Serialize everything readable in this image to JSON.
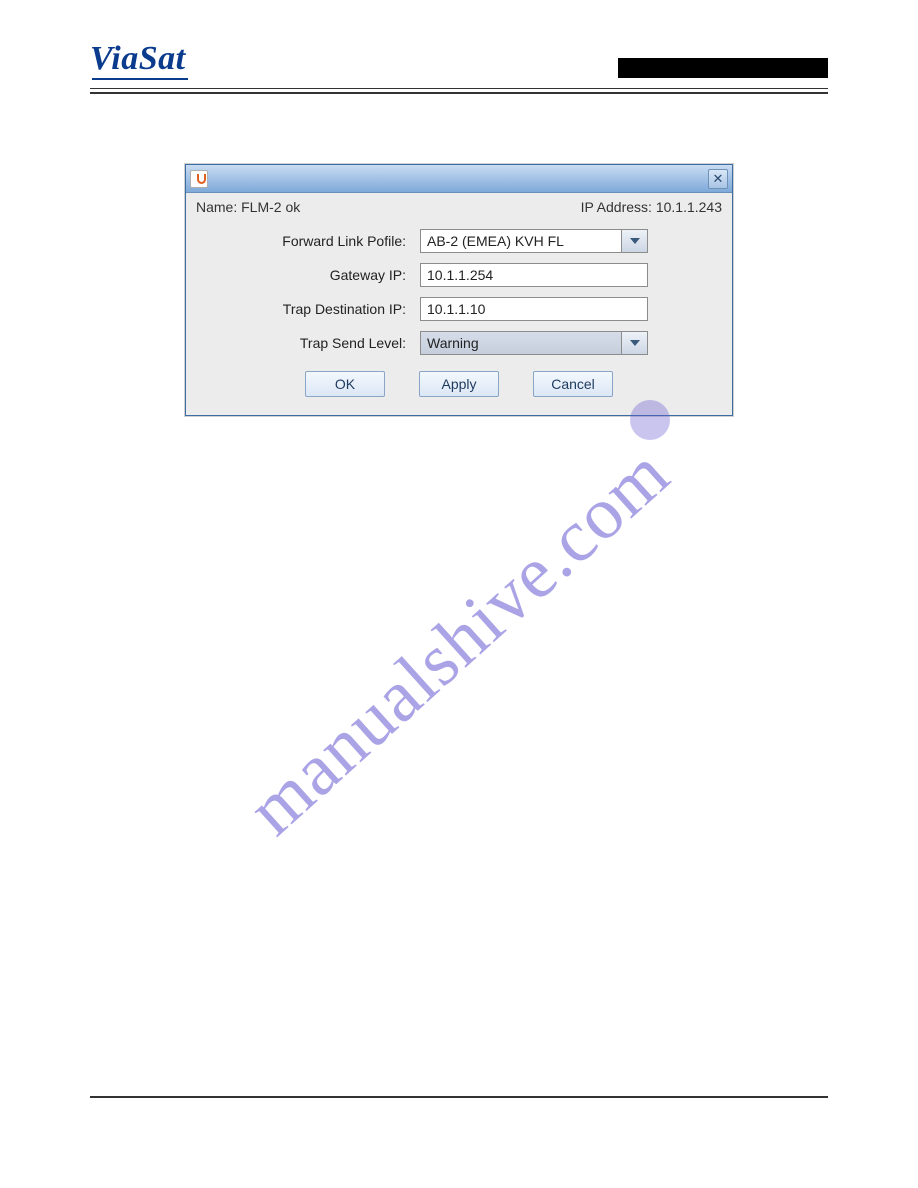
{
  "header": {
    "logo_text": "ViaSat"
  },
  "dialog": {
    "name_label": "Name:",
    "name_value": "FLM-2 ok",
    "ip_label": "IP Address:",
    "ip_value": "10.1.1.243",
    "fields": {
      "forward_link_profile": {
        "label": "Forward Link Pofile:",
        "value": "AB-2 (EMEA) KVH FL"
      },
      "gateway_ip": {
        "label": "Gateway IP:",
        "value": "10.1.1.254"
      },
      "trap_destination_ip": {
        "label": "Trap Destination IP:",
        "value": "10.1.1.10"
      },
      "trap_send_level": {
        "label": "Trap Send Level:",
        "value": "Warning"
      }
    },
    "buttons": {
      "ok": "OK",
      "apply": "Apply",
      "cancel": "Cancel"
    }
  },
  "watermark": "manualshive.com"
}
